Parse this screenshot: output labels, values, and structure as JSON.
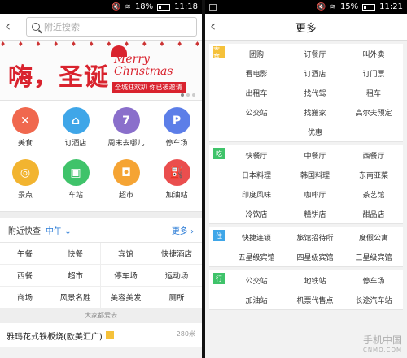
{
  "left": {
    "status": {
      "battery": "18%",
      "time": "11:18"
    },
    "search": {
      "placeholder": "附近搜索"
    },
    "banner": {
      "headline": "嗨，圣诞",
      "merry": "Merry",
      "christmas": "Christmas",
      "slogan": "全城狂欢趴 你已被邀请"
    },
    "categories": [
      {
        "label": "美食",
        "icon": "fork-knife-icon",
        "glyph": "✕",
        "color": "#f0684e"
      },
      {
        "label": "订酒店",
        "icon": "bed-icon",
        "glyph": "⌂",
        "color": "#3fa6e8"
      },
      {
        "label": "周末去哪儿",
        "icon": "calendar-icon",
        "glyph": "7",
        "color": "#8a6fcb"
      },
      {
        "label": "停车场",
        "icon": "parking-icon",
        "glyph": "P",
        "color": "#5c7ee8"
      },
      {
        "label": "景点",
        "icon": "balloon-icon",
        "glyph": "◎",
        "color": "#f2b430"
      },
      {
        "label": "车站",
        "icon": "bus-icon",
        "glyph": "▣",
        "color": "#3fc36a"
      },
      {
        "label": "超市",
        "icon": "shopping-bag-icon",
        "glyph": "◘",
        "color": "#f5a434"
      },
      {
        "label": "加油站",
        "icon": "fuel-pump-icon",
        "glyph": "⛽",
        "color": "#ea4e4e"
      }
    ],
    "nearby": {
      "title": "附近快查",
      "selected": "中午",
      "more": "更多",
      "rows": [
        [
          "午餐",
          "快餐",
          "宾馆",
          "快捷酒店"
        ],
        [
          "西餐",
          "超市",
          "停车场",
          "运动场"
        ],
        [
          "商场",
          "风景名胜",
          "美容美发",
          "厕所"
        ]
      ]
    },
    "love_label": "大家都爱去",
    "restaurant": {
      "name": "雅玛花式铁板烧(欧美汇广)",
      "distance": "280米"
    }
  },
  "right": {
    "status": {
      "battery": "15%",
      "time": "11:21"
    },
    "title": "更多",
    "sections": [
      {
        "tag": "美食",
        "color": "#f5c13a",
        "items": [
          "团购",
          "订餐厅",
          "叫外卖",
          "看电影",
          "订酒店",
          "订门票",
          "出租车",
          "找代驾",
          "租车",
          "公交站",
          "找搬家",
          "高尔夫预定",
          "优惠"
        ]
      },
      {
        "tag": "吃",
        "color": "#3fc36a",
        "items": [
          "快餐厅",
          "中餐厅",
          "西餐厅",
          "日本料理",
          "韩国料理",
          "东南亚菜",
          "印度风味",
          "咖啡厅",
          "茶艺馆",
          "冷饮店",
          "糕饼店",
          "甜品店"
        ]
      },
      {
        "tag": "住",
        "color": "#3fa6e8",
        "items": [
          "快捷连锁",
          "旅馆招待所",
          "度假公寓",
          "五星级宾馆",
          "四星级宾馆",
          "三星级宾馆"
        ]
      },
      {
        "tag": "行",
        "color": "#3fc36a",
        "items": [
          "公交站",
          "地铁站",
          "停车场",
          "加油站",
          "机票代售点",
          "长途汽车站"
        ]
      }
    ],
    "watermark": {
      "main": "手机中国",
      "sub": "CNMO.COM"
    }
  }
}
